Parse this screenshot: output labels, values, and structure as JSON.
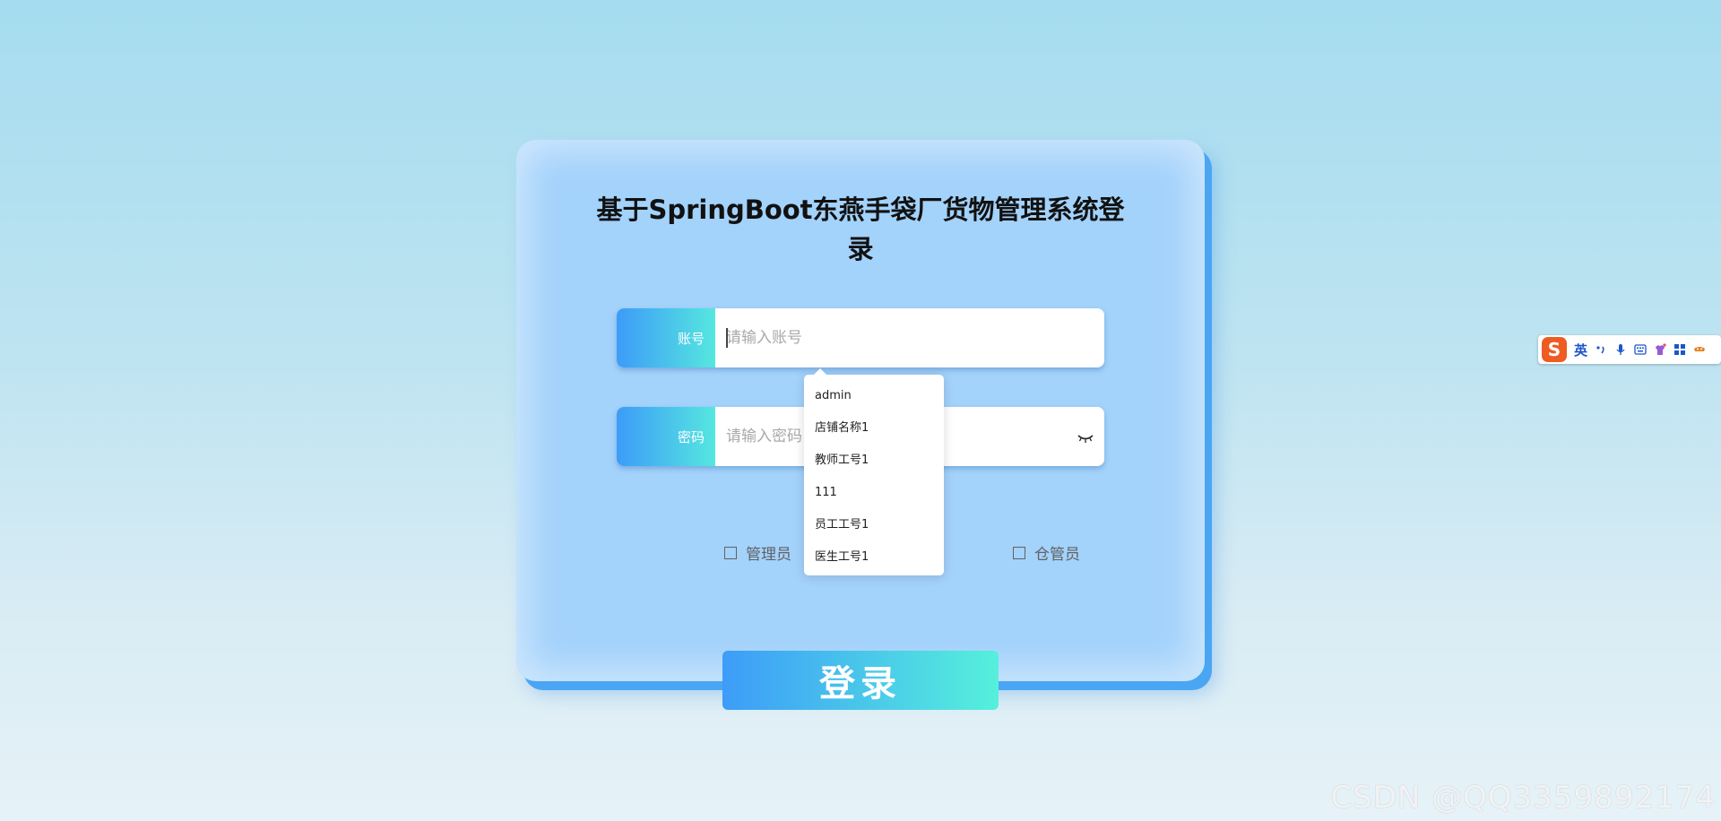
{
  "form": {
    "title": "基于SpringBoot东燕手袋厂货物管理系统登录",
    "account_label": "账号",
    "account_placeholder": "请输入账号",
    "password_label": "密码",
    "password_placeholder": "请输入密码",
    "login_label": "登录"
  },
  "roles": [
    {
      "label": "管理员"
    },
    {
      "label": "仓管员"
    }
  ],
  "autocomplete": {
    "options": [
      "admin",
      "店铺名称1",
      "教师工号1",
      "111",
      "员工工号1",
      "医生工号1"
    ]
  },
  "ime": {
    "logo": "S",
    "mode": "英",
    "icons": [
      "punctuation-icon",
      "microphone-icon",
      "keyboard-icon",
      "skin-icon",
      "toolbox-icon",
      "more-icon"
    ]
  },
  "watermark": "CSDN @QQ3359892174",
  "colors": {
    "gradient_start": "#3d9cf8",
    "gradient_end": "#55e7df",
    "card_bg": "#a3d2fb"
  }
}
